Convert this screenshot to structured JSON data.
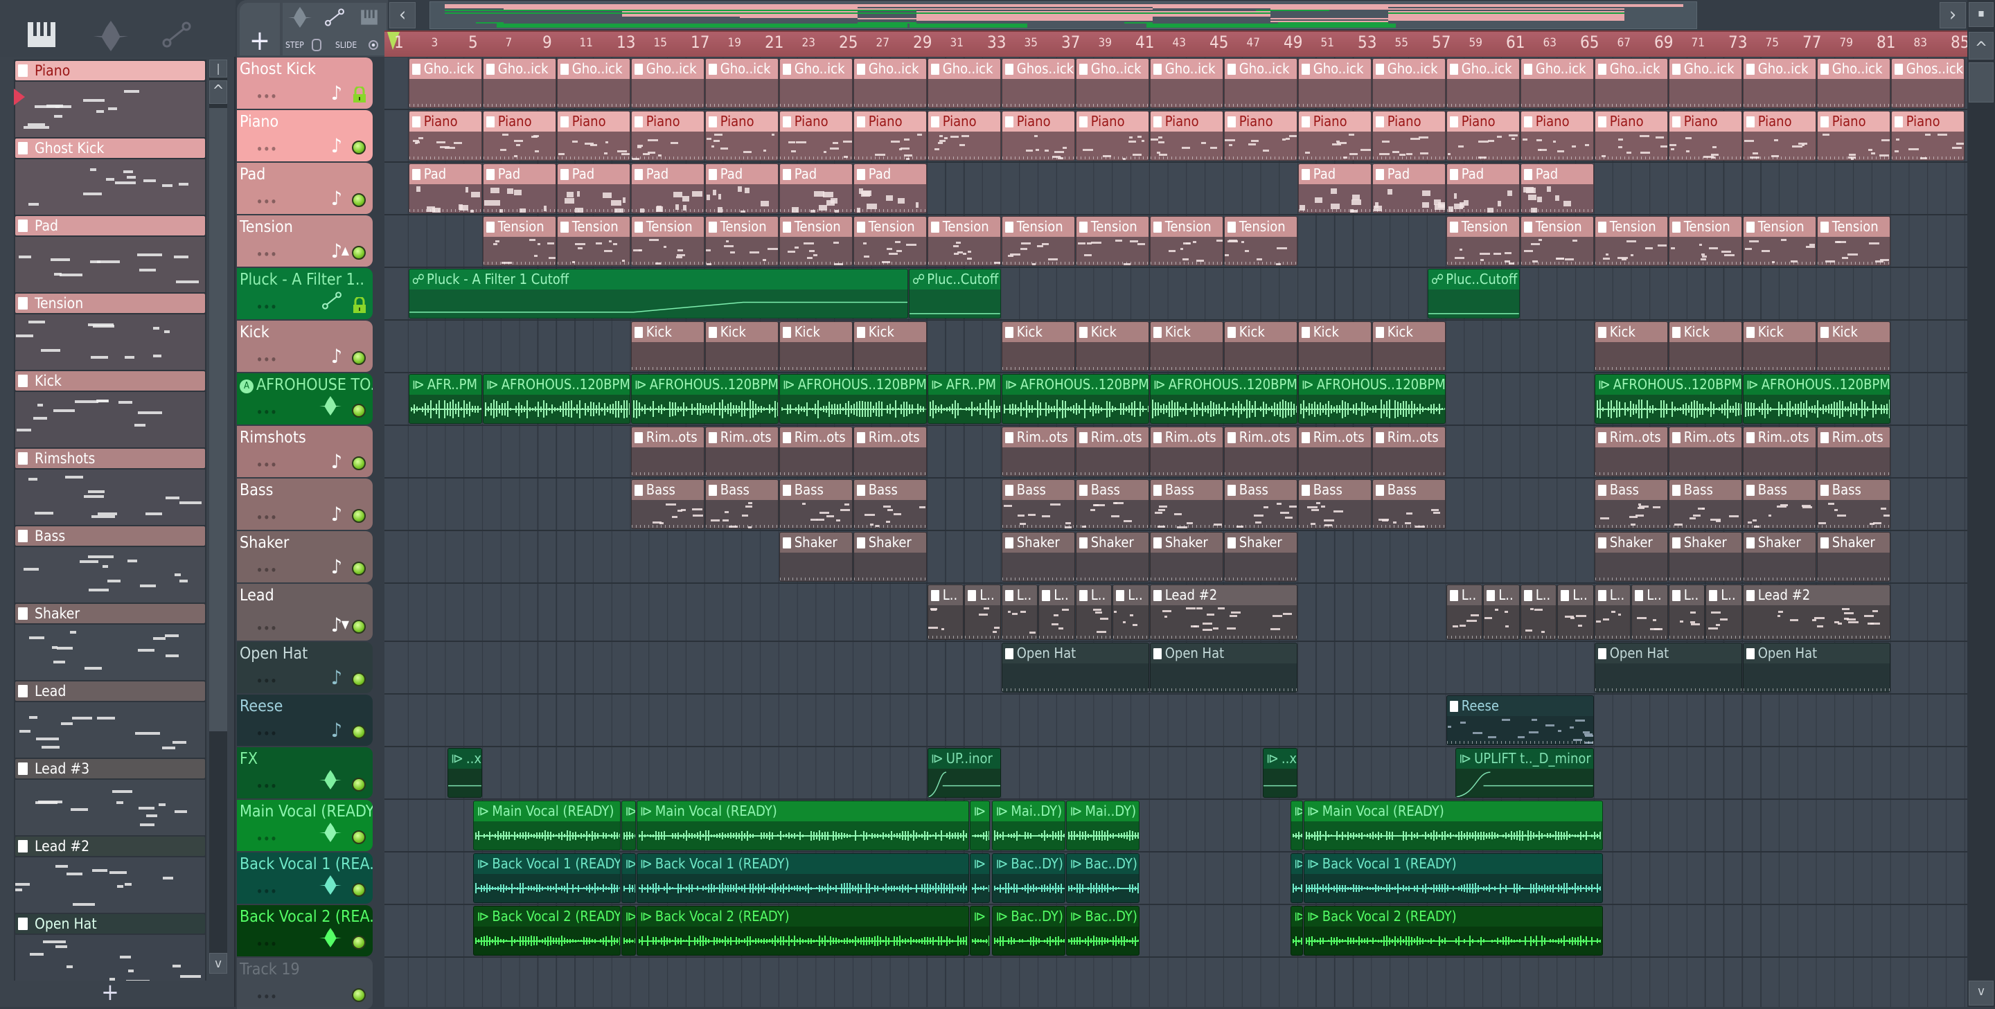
{
  "pattern_picker": {
    "tools": [
      "piano-roll-icon",
      "audio-icon",
      "automation-icon"
    ],
    "add_label": "+",
    "patterns": [
      {
        "name": "Piano",
        "head": "#edb4b4",
        "text": "#9a1616",
        "body": "#5f555d"
      },
      {
        "name": "Ghost Kick",
        "head": "#e0a2a4",
        "text": "#ffffff",
        "body": "#5f555d"
      },
      {
        "name": "Pad",
        "head": "#d69c9e",
        "text": "#ffffff",
        "body": "#5a5259"
      },
      {
        "name": "Tension",
        "head": "#c99394",
        "text": "#ffffff",
        "body": "#565058"
      },
      {
        "name": "Kick",
        "head": "#b88888",
        "text": "#ffffff",
        "body": "#524e56"
      },
      {
        "name": "Rimshots",
        "head": "#ae8384",
        "text": "#ffffff",
        "body": "#4c4c55"
      },
      {
        "name": "Bass",
        "head": "#977676",
        "text": "#ffffff",
        "body": "#474b54"
      },
      {
        "name": "Shaker",
        "head": "#7c6868",
        "text": "#ffffff",
        "body": "#434a53"
      },
      {
        "name": "Lead",
        "head": "#6a5f60",
        "text": "#ffffff",
        "body": "#414851"
      },
      {
        "name": "Lead #3",
        "head": "#595657",
        "text": "#ffffff",
        "body": "#414851"
      },
      {
        "name": "Lead #2",
        "head": "#384442",
        "text": "#ffffff",
        "body": "#3f4650"
      },
      {
        "name": "Open Hat",
        "head": "#2f3f3e",
        "text": "#dfe",
        "body": "#3d444e"
      }
    ]
  },
  "toolbar": {
    "add_track_label": "+",
    "step_label": "STEP",
    "slide_label": "SLIDE",
    "scroll_left": "‹",
    "scroll_right": "›",
    "scroll_up": "^",
    "scroll_down": "v"
  },
  "ruler": {
    "labels": [
      "1",
      "3",
      "5",
      "7",
      "9",
      "11",
      "13",
      "15",
      "17",
      "19",
      "21",
      "23",
      "25",
      "27",
      "29",
      "31",
      "33",
      "35",
      "37",
      "39",
      "41",
      "43",
      "45",
      "47",
      "49",
      "51",
      "53",
      "55",
      "57",
      "59",
      "61",
      "63",
      "65",
      "67",
      "69",
      "71",
      "73",
      "75",
      "77",
      "79",
      "81",
      "83",
      "85"
    ]
  },
  "tracks": [
    {
      "name": "Ghost Kick",
      "icon": "note",
      "extra": "lock",
      "hbg": "#e39c9f",
      "htx": "#ffffff",
      "type": "pattern",
      "ch": "#dca0a3",
      "cb": "#7a5a60",
      "ct": "#ffffff",
      "clips": [
        [
          2,
          4,
          "Gho..ick"
        ],
        [
          6,
          4,
          "Gho..ick"
        ],
        [
          10,
          4,
          "Gho..ick"
        ],
        [
          14,
          4,
          "Gho..ick"
        ],
        [
          18,
          4,
          "Gho..ick"
        ],
        [
          22,
          4,
          "Gho..ick"
        ],
        [
          26,
          4,
          "Gho..ick"
        ],
        [
          30,
          4,
          "Gho..ick"
        ],
        [
          34,
          4,
          "Ghos..ick"
        ],
        [
          38,
          4,
          "Gho..ick"
        ],
        [
          42,
          4,
          "Gho..ick"
        ],
        [
          46,
          4,
          "Gho..ick"
        ],
        [
          50,
          4,
          "Gho..ick"
        ],
        [
          54,
          4,
          "Gho..ick"
        ],
        [
          58,
          4,
          "Gho..ick"
        ],
        [
          62,
          4,
          "Gho..ick"
        ],
        [
          66,
          4,
          "Gho..ick"
        ],
        [
          70,
          4,
          "Gho..ick"
        ],
        [
          74,
          4,
          "Gho..ick"
        ],
        [
          78,
          4,
          "Gho..ick"
        ],
        [
          82,
          4,
          "Ghos..ick"
        ]
      ]
    },
    {
      "name": "Piano",
      "icon": "note",
      "extra": "",
      "hbg": "#f5a8a8",
      "htx": "#ffffff",
      "type": "pattern",
      "ch": "#eab0b0",
      "cb": "#7f5c62",
      "ct": "#9a1616",
      "clips": [
        [
          2,
          4,
          "Piano"
        ],
        [
          6,
          4,
          "Piano"
        ],
        [
          10,
          4,
          "Piano"
        ],
        [
          14,
          4,
          "Piano"
        ],
        [
          18,
          4,
          "Piano"
        ],
        [
          22,
          4,
          "Piano"
        ],
        [
          26,
          4,
          "Piano"
        ],
        [
          30,
          4,
          "Piano"
        ],
        [
          34,
          4,
          "Piano"
        ],
        [
          38,
          4,
          "Piano"
        ],
        [
          42,
          4,
          "Piano"
        ],
        [
          46,
          4,
          "Piano"
        ],
        [
          50,
          4,
          "Piano"
        ],
        [
          54,
          4,
          "Piano"
        ],
        [
          58,
          4,
          "Piano"
        ],
        [
          62,
          4,
          "Piano"
        ],
        [
          66,
          4,
          "Piano"
        ],
        [
          70,
          4,
          "Piano"
        ],
        [
          74,
          4,
          "Piano"
        ],
        [
          78,
          4,
          "Piano"
        ],
        [
          82,
          4,
          "Piano"
        ]
      ]
    },
    {
      "name": "Pad",
      "icon": "note",
      "extra": "",
      "hbg": "#cf9292",
      "htx": "#ffffff",
      "type": "pattern",
      "ch": "#d59a9c",
      "cb": "#765860",
      "ct": "#ffffff",
      "clips": [
        [
          2,
          4,
          "Pad"
        ],
        [
          6,
          4,
          "Pad"
        ],
        [
          10,
          4,
          "Pad"
        ],
        [
          14,
          4,
          "Pad"
        ],
        [
          18,
          4,
          "Pad"
        ],
        [
          22,
          4,
          "Pad"
        ],
        [
          26,
          4,
          "Pad"
        ],
        [
          50,
          4,
          "Pad"
        ],
        [
          54,
          4,
          "Pad"
        ],
        [
          58,
          4,
          "Pad"
        ],
        [
          62,
          4,
          "Pad"
        ]
      ]
    },
    {
      "name": "Tension",
      "icon": "note",
      "extra": "up",
      "hbg": "#c48d8e",
      "htx": "#ffffff",
      "type": "pattern",
      "ch": "#c99394",
      "cb": "#6e555b",
      "ct": "#ffffff",
      "clips": [
        [
          6,
          4,
          "Tension"
        ],
        [
          10,
          4,
          "Tension"
        ],
        [
          14,
          4,
          "Tension"
        ],
        [
          18,
          4,
          "Tension"
        ],
        [
          22,
          4,
          "Tension"
        ],
        [
          26,
          4,
          "Tension"
        ],
        [
          30,
          4,
          "Tension"
        ],
        [
          34,
          4,
          "Tension"
        ],
        [
          38,
          4,
          "Tension"
        ],
        [
          42,
          4,
          "Tension"
        ],
        [
          46,
          4,
          "Tension"
        ],
        [
          58,
          4,
          "Tension"
        ],
        [
          62,
          4,
          "Tension"
        ],
        [
          66,
          4,
          "Tension"
        ],
        [
          70,
          4,
          "Tension"
        ],
        [
          74,
          4,
          "Tension"
        ],
        [
          78,
          4,
          "Tension"
        ]
      ]
    },
    {
      "name": "Pluck - A Filter 1..",
      "icon": "auto",
      "extra": "lock",
      "hbg": "#087a38",
      "htx": "#8ff0b0",
      "type": "auto",
      "ch": "#0b7d3b",
      "cb": "#0f5e33",
      "ct": "#9ff5bf",
      "clips": [
        [
          2,
          27,
          "Pluck - A Filter 1 Cutoff"
        ],
        [
          29,
          5,
          "Pluc..Cutoff"
        ],
        [
          57,
          5,
          "Pluc..Cutoff"
        ]
      ]
    },
    {
      "name": "Kick",
      "icon": "note",
      "extra": "",
      "hbg": "#ac7e7f",
      "htx": "#ffffff",
      "type": "pattern",
      "ch": "#a98080",
      "cb": "#5e4c50",
      "ct": "#ffffff",
      "clips": [
        [
          14,
          4,
          "Kick"
        ],
        [
          18,
          4,
          "Kick"
        ],
        [
          22,
          4,
          "Kick"
        ],
        [
          26,
          4,
          "Kick"
        ],
        [
          34,
          4,
          "Kick"
        ],
        [
          38,
          4,
          "Kick"
        ],
        [
          42,
          4,
          "Kick"
        ],
        [
          46,
          4,
          "Kick"
        ],
        [
          50,
          4,
          "Kick"
        ],
        [
          54,
          4,
          "Kick"
        ],
        [
          66,
          4,
          "Kick"
        ],
        [
          70,
          4,
          "Kick"
        ],
        [
          74,
          4,
          "Kick"
        ],
        [
          78,
          4,
          "Kick"
        ]
      ]
    },
    {
      "name": "AFROHOUSE TO..",
      "icon": "wave",
      "extra": "badge",
      "badge": "A",
      "hbg": "#07702a",
      "htx": "#8ff0a8",
      "type": "audio",
      "ch": "#0a7a30",
      "cb": "#0e5426",
      "ct": "#9cf5b4",
      "clips": [
        [
          2,
          4,
          "AFR..PM"
        ],
        [
          6,
          8,
          "AFROHOUS..120BPM"
        ],
        [
          14,
          8,
          "AFROHOUS..120BPM"
        ],
        [
          22,
          8,
          "AFROHOUS..120BPM"
        ],
        [
          30,
          4,
          "AFR..PM"
        ],
        [
          34,
          8,
          "AFROHOUS..120BPM"
        ],
        [
          42,
          8,
          "AFROHOUS..120BPM"
        ],
        [
          50,
          8,
          "AFROHOUS..120BPM"
        ],
        [
          66,
          8,
          "AFROHOUS..120BPM"
        ],
        [
          74,
          8,
          "AFROHOUS..120BPM"
        ]
      ]
    },
    {
      "name": "Rimshots",
      "icon": "note",
      "extra": "",
      "hbg": "#a37778",
      "htx": "#ffffff",
      "type": "pattern",
      "ch": "#a37c7d",
      "cb": "#584a4f",
      "ct": "#ffffff",
      "clips": [
        [
          14,
          4,
          "Rim..ots"
        ],
        [
          18,
          4,
          "Rim..ots"
        ],
        [
          22,
          4,
          "Rim..ots"
        ],
        [
          26,
          4,
          "Rim..ots"
        ],
        [
          34,
          4,
          "Rim..ots"
        ],
        [
          38,
          4,
          "Rim..ots"
        ],
        [
          42,
          4,
          "Rim..ots"
        ],
        [
          46,
          4,
          "Rim..ots"
        ],
        [
          50,
          4,
          "Rim..ots"
        ],
        [
          54,
          4,
          "Rim..ots"
        ],
        [
          66,
          4,
          "Rim..ots"
        ],
        [
          70,
          4,
          "Rim..ots"
        ],
        [
          74,
          4,
          "Rim..ots"
        ],
        [
          78,
          4,
          "Rim..ots"
        ]
      ]
    },
    {
      "name": "Bass",
      "icon": "note",
      "extra": "",
      "hbg": "#8d6e6e",
      "htx": "#ffffff",
      "type": "pattern",
      "ch": "#957676",
      "cb": "#544a4f",
      "ct": "#ffffff",
      "clips": [
        [
          14,
          4,
          "Bass"
        ],
        [
          18,
          4,
          "Bass"
        ],
        [
          22,
          4,
          "Bass"
        ],
        [
          26,
          4,
          "Bass"
        ],
        [
          34,
          4,
          "Bass"
        ],
        [
          38,
          4,
          "Bass"
        ],
        [
          42,
          4,
          "Bass"
        ],
        [
          46,
          4,
          "Bass"
        ],
        [
          50,
          4,
          "Bass"
        ],
        [
          54,
          4,
          "Bass"
        ],
        [
          66,
          4,
          "Bass"
        ],
        [
          70,
          4,
          "Bass"
        ],
        [
          74,
          4,
          "Bass"
        ],
        [
          78,
          4,
          "Bass"
        ]
      ]
    },
    {
      "name": "Shaker",
      "icon": "note",
      "extra": "",
      "hbg": "#786464",
      "htx": "#ffffff",
      "type": "pattern",
      "ch": "#7d6869",
      "cb": "#4e474c",
      "ct": "#ffffff",
      "clips": [
        [
          22,
          4,
          "Shaker"
        ],
        [
          26,
          4,
          "Shaker"
        ],
        [
          34,
          4,
          "Shaker"
        ],
        [
          38,
          4,
          "Shaker"
        ],
        [
          42,
          4,
          "Shaker"
        ],
        [
          46,
          4,
          "Shaker"
        ],
        [
          66,
          4,
          "Shaker"
        ],
        [
          70,
          4,
          "Shaker"
        ],
        [
          74,
          4,
          "Shaker"
        ],
        [
          78,
          4,
          "Shaker"
        ]
      ]
    },
    {
      "name": "Lead",
      "icon": "note",
      "extra": "down",
      "hbg": "#6a5e5f",
      "htx": "#ffffff",
      "type": "pattern",
      "ch": "#6a6062",
      "cb": "#494447",
      "ct": "#ffffff",
      "clips": [
        [
          30,
          2,
          "L.."
        ],
        [
          32,
          2,
          "L.."
        ],
        [
          34,
          2,
          "L.."
        ],
        [
          36,
          2,
          "L.."
        ],
        [
          38,
          2,
          "L.."
        ],
        [
          40,
          2,
          "L.."
        ],
        [
          42,
          8,
          "Lead #2"
        ],
        [
          58,
          2,
          "L.."
        ],
        [
          60,
          2,
          "L.."
        ],
        [
          62,
          2,
          "L.."
        ],
        [
          64,
          2,
          "L.."
        ],
        [
          66,
          2,
          "L.."
        ],
        [
          68,
          2,
          "L.."
        ],
        [
          70,
          2,
          "L.."
        ],
        [
          72,
          2,
          "L.."
        ],
        [
          74,
          8,
          "Lead #2"
        ]
      ]
    },
    {
      "name": "Open Hat",
      "icon": "note",
      "extra": "",
      "hbg": "#2d3c3e",
      "htx": "#c9dcdc",
      "type": "pattern",
      "ch": "#2f3f40",
      "cb": "#263537",
      "ct": "#c4dada",
      "clips": [
        [
          34,
          8,
          "Open Hat"
        ],
        [
          42,
          8,
          "Open Hat"
        ],
        [
          66,
          8,
          "Open Hat"
        ],
        [
          74,
          8,
          "Open Hat"
        ]
      ]
    },
    {
      "name": "Reese",
      "icon": "note",
      "extra": "",
      "hbg": "#203438",
      "htx": "#9fd0dc",
      "type": "pattern",
      "ch": "#1f3a3c",
      "cb": "#1c3134",
      "ct": "#9fd6e0",
      "clips": [
        [
          58,
          8,
          "Reese"
        ]
      ]
    },
    {
      "name": "FX",
      "icon": "wave",
      "extra": "",
      "hbg": "#0a5a28",
      "htx": "#7ff0a0",
      "type": "audio",
      "ch": "#0c5630",
      "cb": "#123b24",
      "ct": "#7fe0b0",
      "clips": [
        [
          4.1,
          1.9,
          "..x"
        ],
        [
          30,
          4,
          "UP..inor"
        ],
        [
          48.1,
          1.9,
          "..x"
        ],
        [
          58.5,
          7.5,
          "UPLIFT t.._D_minor"
        ]
      ]
    },
    {
      "name": "Main Vocal (READY)",
      "icon": "wave",
      "extra": "",
      "hbg": "#098a2a",
      "htx": "#90f5b0",
      "type": "audio",
      "ch": "#0f8a2e",
      "cb": "#0b5a22",
      "ct": "#90f5b0",
      "clips": [
        [
          5.5,
          8,
          "Main Vocal (READY)"
        ],
        [
          13.5,
          0.8,
          ""
        ],
        [
          14.3,
          18,
          "Main Vocal (READY)"
        ],
        [
          32.3,
          1.1,
          ""
        ],
        [
          33.5,
          4,
          "Mai..DY)"
        ],
        [
          37.5,
          4,
          "Mai..DY)"
        ],
        [
          49.6,
          0.7,
          ""
        ],
        [
          50.3,
          16.2,
          "Main Vocal (READY)"
        ]
      ]
    },
    {
      "name": "Back Vocal 1 (REA..",
      "icon": "wave",
      "extra": "",
      "hbg": "#0a4f40",
      "htx": "#70e8c8",
      "type": "audio",
      "ch": "#0c4f40",
      "cb": "#0f3a31",
      "ct": "#70e8c8",
      "clips": [
        [
          5.5,
          8,
          "Back Vocal 1 (READY)"
        ],
        [
          13.5,
          0.8,
          ""
        ],
        [
          14.3,
          18,
          "Back Vocal 1 (READY)"
        ],
        [
          32.3,
          1.1,
          ""
        ],
        [
          33.5,
          4,
          "Bac..DY)"
        ],
        [
          37.5,
          4,
          "Bac..DY)"
        ],
        [
          49.6,
          0.7,
          ""
        ],
        [
          50.3,
          16.2,
          "Back Vocal 1 (READY)"
        ]
      ]
    },
    {
      "name": "Back Vocal 2 (REA..",
      "icon": "wave",
      "extra": "",
      "hbg": "#053f0e",
      "htx": "#55ff66",
      "type": "audio",
      "ch": "#0a4a14",
      "cb": "#073a0e",
      "ct": "#55ff66",
      "clips": [
        [
          5.5,
          8,
          "Back Vocal 2 (READY)"
        ],
        [
          13.5,
          0.8,
          ""
        ],
        [
          14.3,
          18,
          "Back Vocal 2 (READY)"
        ],
        [
          32.3,
          1.1,
          ""
        ],
        [
          33.5,
          4,
          "Bac..DY)"
        ],
        [
          37.5,
          4,
          "Bac..DY)"
        ],
        [
          49.6,
          0.7,
          ""
        ],
        [
          50.3,
          16.2,
          "Back Vocal 2 (READY)"
        ]
      ]
    },
    {
      "name": "Track 19",
      "icon": "",
      "extra": "",
      "hbg": "#424a53",
      "htx": "#6c747c",
      "type": "pattern",
      "ch": "#444",
      "cb": "#333",
      "ct": "#fff",
      "clips": []
    }
  ]
}
